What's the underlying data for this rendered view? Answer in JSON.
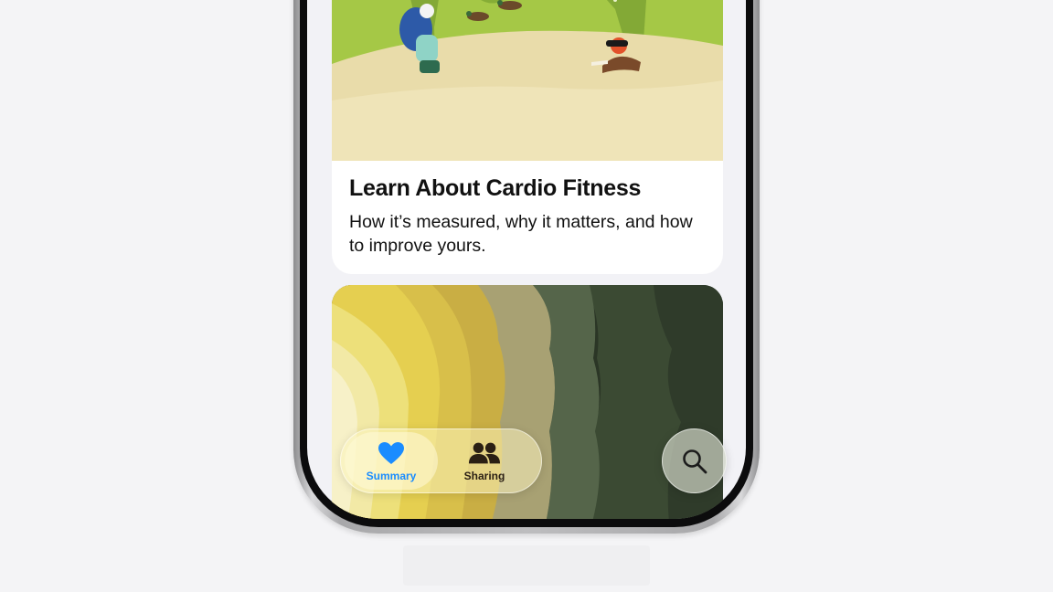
{
  "article_card": {
    "title": "Learn About Cardio Fitness",
    "description": "How it’s measured, why it matters, and how to improve yours."
  },
  "tab_bar": {
    "items": [
      {
        "label": "Summary",
        "icon": "heart-icon",
        "active": true,
        "color": "#1a8cff"
      },
      {
        "label": "Sharing",
        "icon": "people-icon",
        "active": false,
        "color": "#2a1f14"
      }
    ]
  },
  "search": {
    "icon": "magnifying-glass-icon"
  },
  "colors": {
    "accent": "#1a8cff",
    "card_background": "#ffffff",
    "screen_background": "#f2f2f6"
  }
}
